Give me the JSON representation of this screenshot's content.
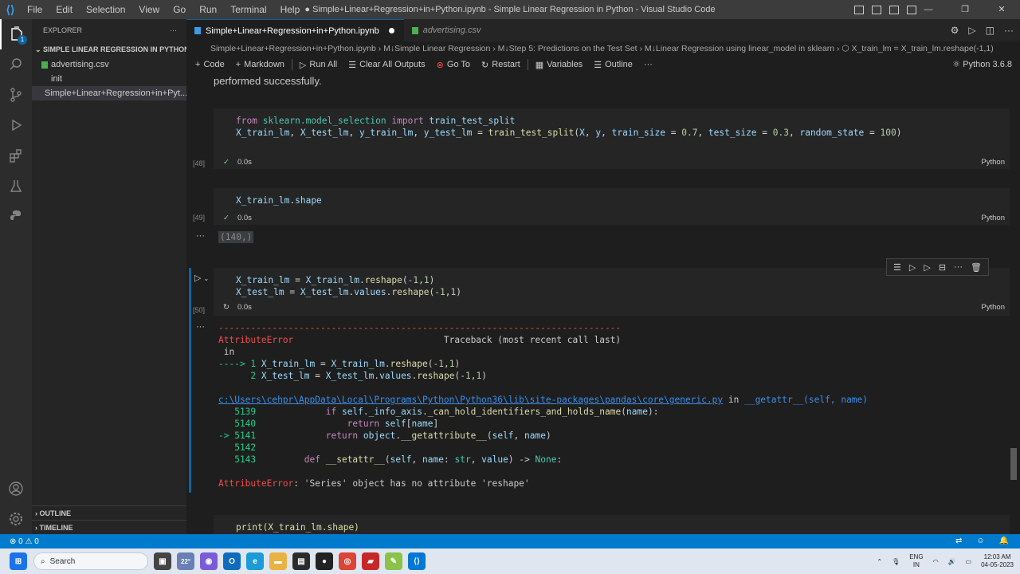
{
  "titlebar": {
    "menu": [
      "File",
      "Edit",
      "Selection",
      "View",
      "Go",
      "Run",
      "Terminal",
      "Help"
    ],
    "title": "● Simple+Linear+Regression+in+Python.ipynb - Simple Linear Regression in Python - Visual Studio Code",
    "controls": {
      "minimize": "—",
      "maximize": "❐",
      "close": "✕"
    }
  },
  "activitybar": {
    "explorer_badge": "1"
  },
  "sidebar": {
    "header": "EXPLORER",
    "more": "···",
    "folder": "SIMPLE LINEAR REGRESSION IN PYTHON",
    "files": [
      "advertising.csv",
      "init",
      "Simple+Linear+Regression+in+Pyt..."
    ],
    "outline": "OUTLINE",
    "timeline": "TIMELINE"
  },
  "tabs": [
    {
      "label": "Simple+Linear+Regression+in+Python.ipynb"
    },
    {
      "label": "advertising.csv"
    }
  ],
  "breadcrumb": "Simple+Linear+Regression+in+Python.ipynb  ›  M↓Simple Linear Regression  ›  M↓Step 5: Predictions on the Test Set  ›  M↓Linear Regression using linear_model in sklearn  ›  ⬡ X_train_lm = X_train_lm.reshape(-1,1)",
  "toolbar": {
    "code": "Code",
    "markdown": "Markdown",
    "run_all": "Run All",
    "clear": "Clear All Outputs",
    "goto": "Go To",
    "restart": "Restart",
    "variables": "Variables",
    "outline": "Outline",
    "more": "···",
    "kernel": "Python 3.6.8"
  },
  "notebook": {
    "md_text": "performed successfully.",
    "cell1": {
      "count": "[48]",
      "time": "0.0s",
      "lang": "Python"
    },
    "cell2": {
      "count": "[49]",
      "time": "0.0s",
      "lang": "Python",
      "output": "(140,)"
    },
    "cell3": {
      "count": "[50]",
      "time": "0.0s",
      "lang": "Python"
    },
    "cell4": {
      "code": "print(X_train_lm.shape)"
    },
    "traceback": {
      "dashes": "---------------------------------------------------------------------------",
      "error": "AttributeError",
      "header": "Traceback (most recent call last)",
      "in": " in",
      "path": "c:\\Users\\cehpr\\AppData\\Local\\Programs\\Python\\Python36\\lib\\site-packages\\pandas\\core\\generic.py",
      "in2": " in ",
      "func": "__getattr__(self, name)",
      "final_msg": ": 'Series' object has no attribute 'reshape'"
    },
    "out_more": "···"
  },
  "statusbar": {
    "problems": "⊗ 0 ⚠ 0"
  },
  "taskbar": {
    "search": "Search",
    "weather": "22°",
    "lang1": "ENG",
    "lang2": "IN",
    "time": "12:03 AM",
    "date": "04-05-2023"
  }
}
